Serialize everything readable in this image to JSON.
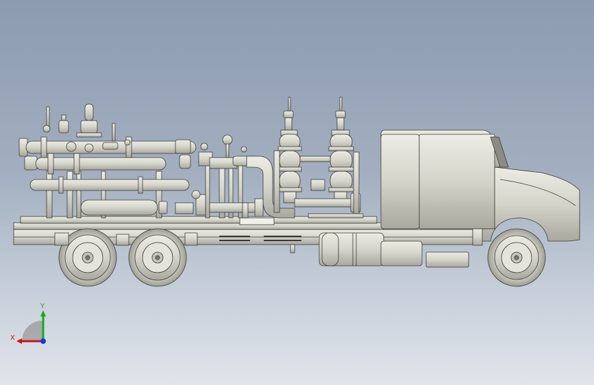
{
  "scene": {
    "model": "truck-mounted-skid-assembly",
    "view": "side",
    "render_style": "shaded-with-edges",
    "colors": {
      "bg_top": "#8c9bb0",
      "bg_bottom": "#e1e5eb",
      "part_fill": "#d9d9cf",
      "part_edge": "#3a3a36",
      "shadow": "#a9a99f"
    }
  },
  "triad": {
    "x_label": "X",
    "y_label": "Y",
    "colors": {
      "x": "#d01010",
      "y": "#18a818",
      "z": "#1838d8",
      "origin": "#9a9a9a"
    }
  }
}
